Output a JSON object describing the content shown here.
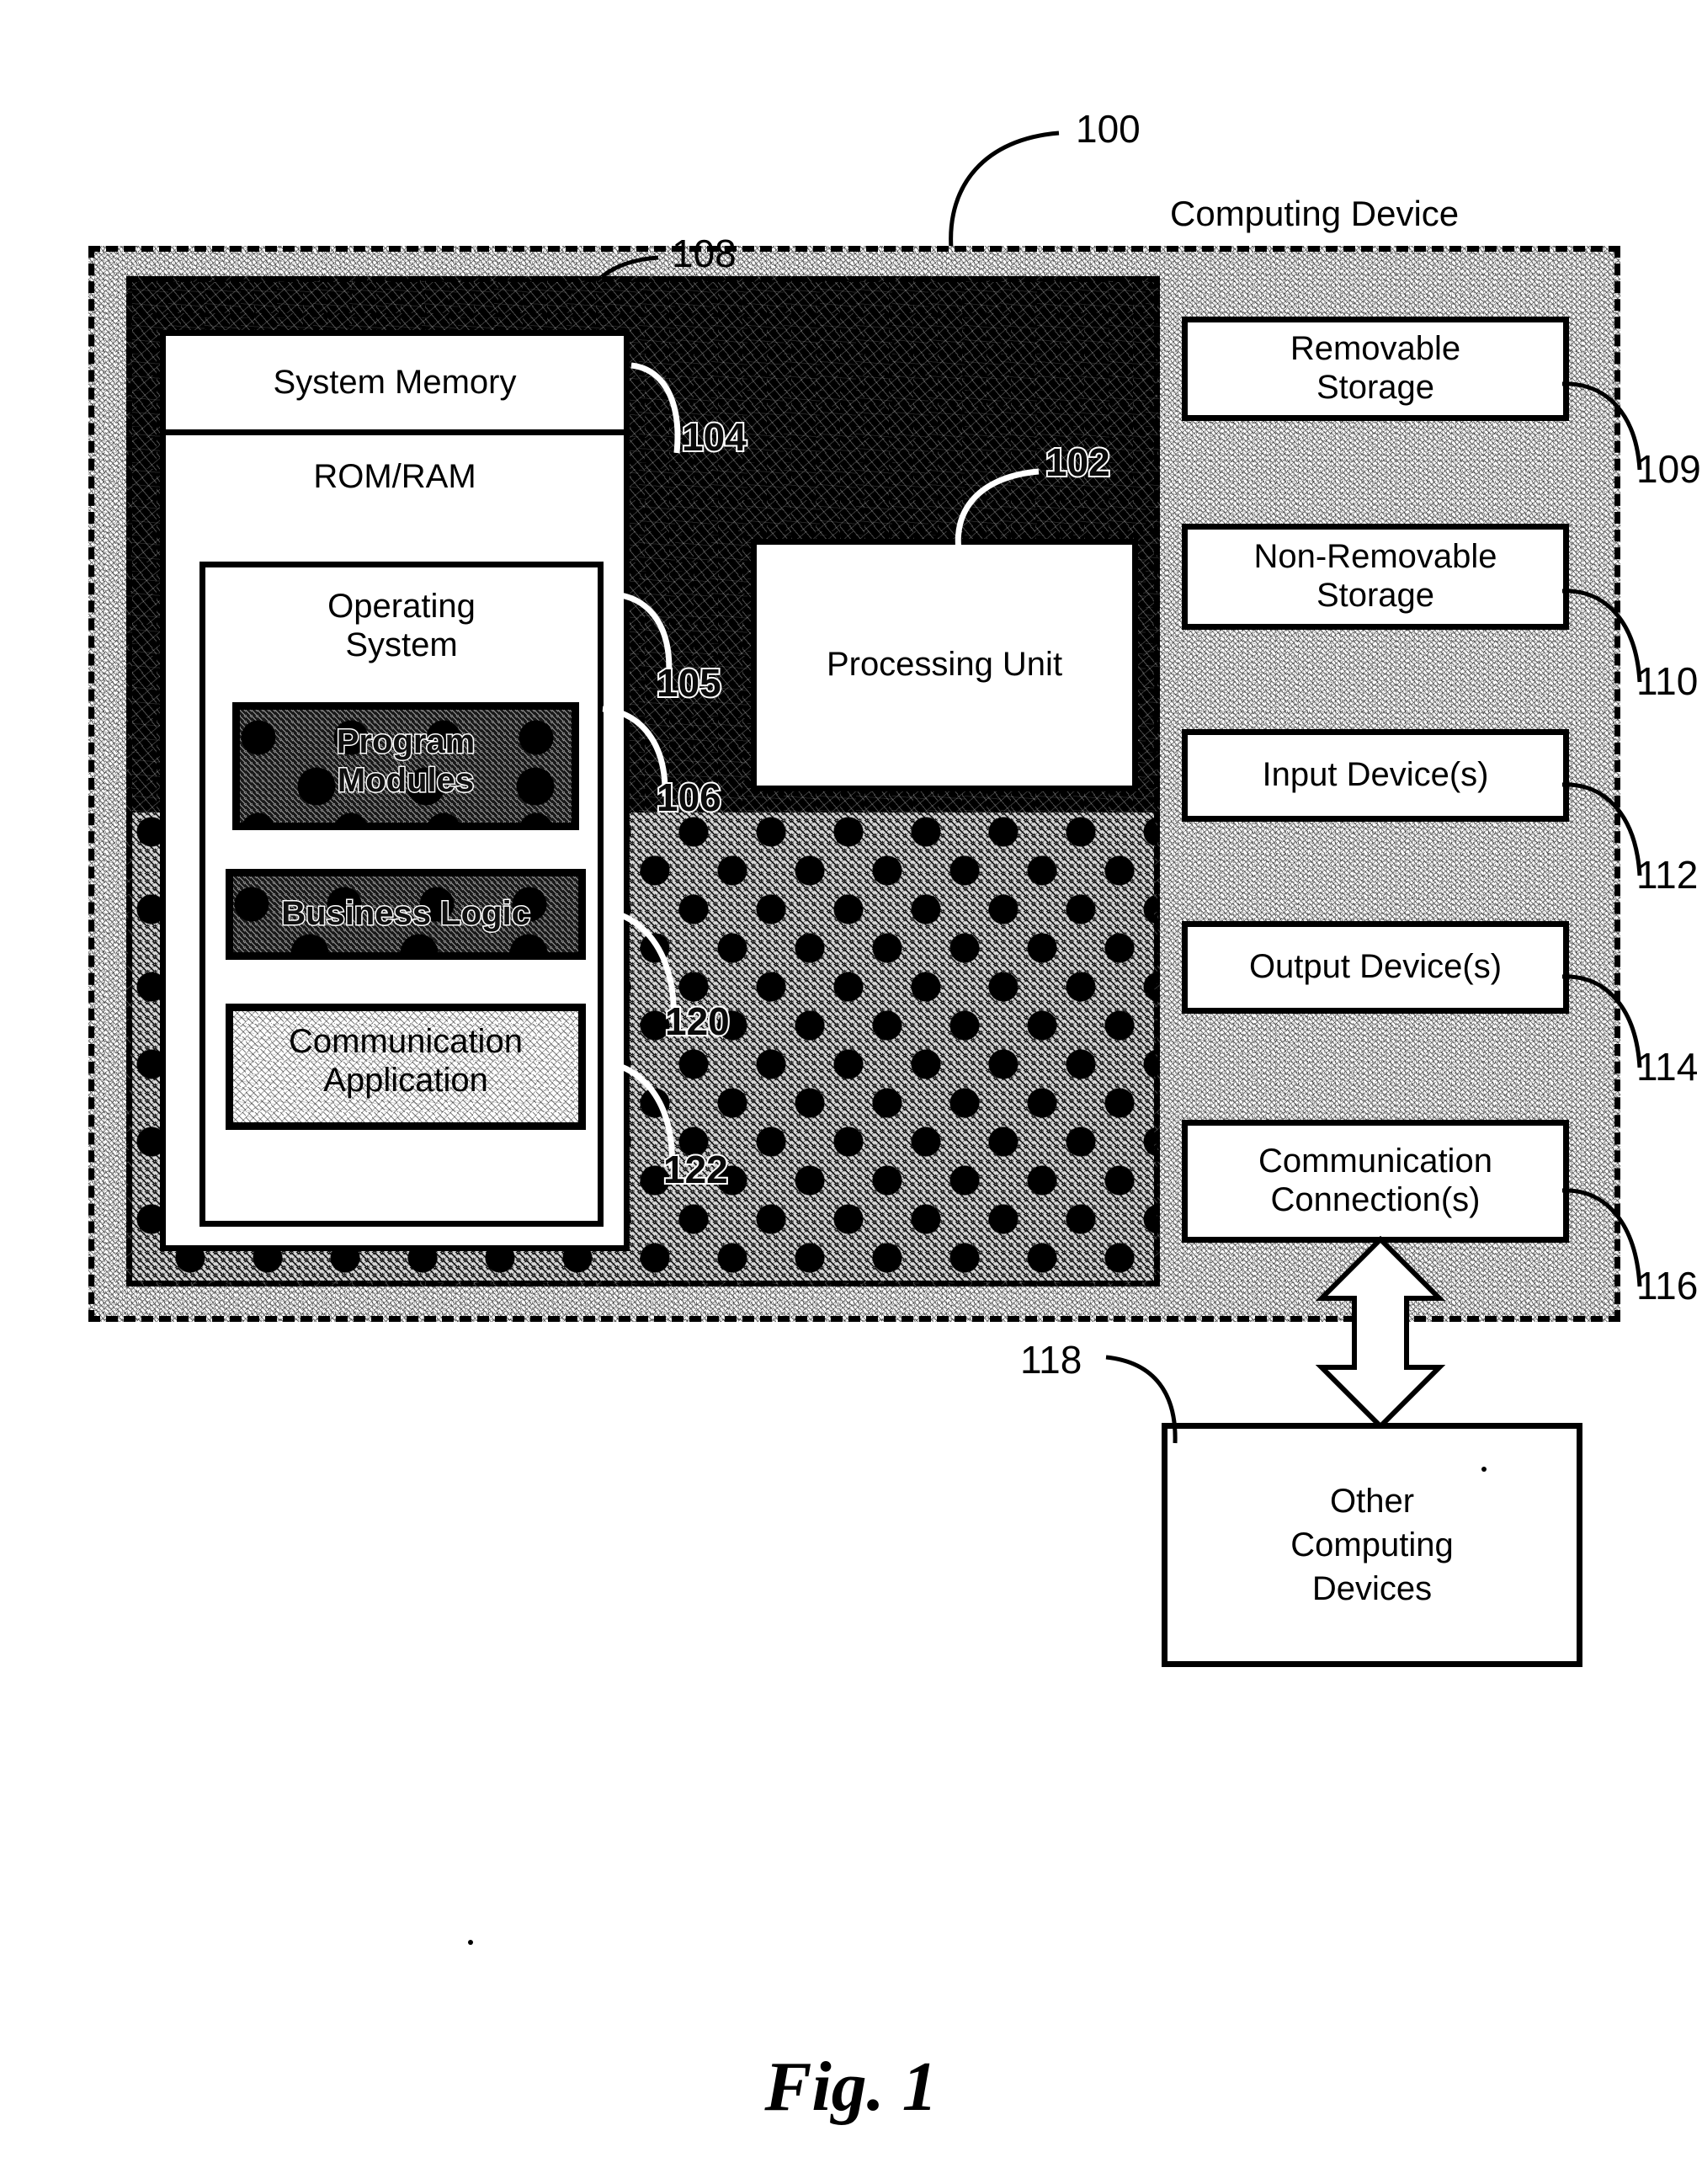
{
  "figure": {
    "caption": "Fig. 1",
    "system_ref": "100",
    "outer_label": "Computing Device"
  },
  "refs": {
    "system": "100",
    "bus_region": "108",
    "processing_unit": "102",
    "system_memory": "104",
    "operating_system": "105",
    "program_modules": "106",
    "business_logic": "120",
    "communication_application": "122",
    "removable_storage": "109",
    "non_removable_storage": "110",
    "input_devices": "112",
    "output_devices": "114",
    "communication_connections": "116",
    "other_computing_devices": "118"
  },
  "memory": {
    "title": "System Memory",
    "subtitle": "ROM/RAM",
    "os_label_line1": "Operating",
    "os_label_line2": "System",
    "modules": [
      {
        "id": "program-modules",
        "line1": "Program",
        "line2": "Modules"
      },
      {
        "id": "business-logic",
        "line1": "Business Logic",
        "line2": ""
      },
      {
        "id": "communication-application",
        "line1": "Communication",
        "line2": "Application"
      }
    ]
  },
  "processing": {
    "label": "Processing Unit"
  },
  "peripherals": [
    {
      "id": "removable-storage",
      "line1": "Removable",
      "line2": "Storage",
      "ref": "109"
    },
    {
      "id": "non-removable-storage",
      "line1": "Non-Removable",
      "line2": "Storage",
      "ref": "110"
    },
    {
      "id": "input-devices",
      "line1": "Input Device(s)",
      "line2": "",
      "ref": "112"
    },
    {
      "id": "output-devices",
      "line1": "Output Device(s)",
      "line2": "",
      "ref": "114"
    },
    {
      "id": "communication-connections",
      "line1": "Communication",
      "line2": "Connection(s)",
      "ref": "116"
    }
  ],
  "external": {
    "line1": "Other",
    "line2": "Computing",
    "line3": "Devices",
    "ref": "118"
  },
  "colors": {
    "ink": "#000000",
    "paper": "#ffffff"
  }
}
